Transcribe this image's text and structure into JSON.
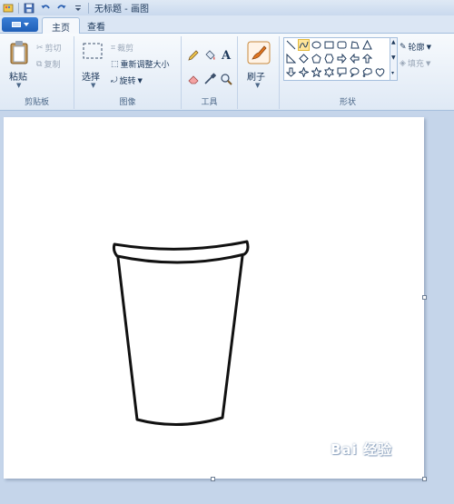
{
  "titlebar": {
    "title": "无标题 - 画图",
    "quick_access": [
      "save-icon",
      "undo-icon",
      "redo-icon",
      "customize-arrow-icon"
    ]
  },
  "tabs": [
    {
      "label": "主页",
      "active": true
    },
    {
      "label": "查看",
      "active": false
    }
  ],
  "ribbon": {
    "clipboard": {
      "label": "剪贴板",
      "paste": "粘贴",
      "cut": "剪切",
      "copy": "复制"
    },
    "image": {
      "label": "图像",
      "select": "选择",
      "crop": "裁剪",
      "resize": "重新调整大小",
      "rotate": "旋转"
    },
    "tools": {
      "label": "工具",
      "items": [
        "pencil-icon",
        "fill-icon",
        "text-icon",
        "eraser-icon",
        "color-picker-icon",
        "magnifier-icon"
      ],
      "text_glyph": "A"
    },
    "brushes": {
      "label": "刷子"
    },
    "shapes": {
      "label": "形状",
      "outline": "轮廓",
      "fill": "填充",
      "selected_shape": "curve"
    }
  },
  "colors": {
    "accent": "#1f5fb8",
    "ribbon_bg": "#dfe9f5",
    "canvas_bg": "#ffffff",
    "workspace_bg": "#c5d5ea",
    "stroke": "#111111"
  },
  "watermark": "Bai 经验"
}
